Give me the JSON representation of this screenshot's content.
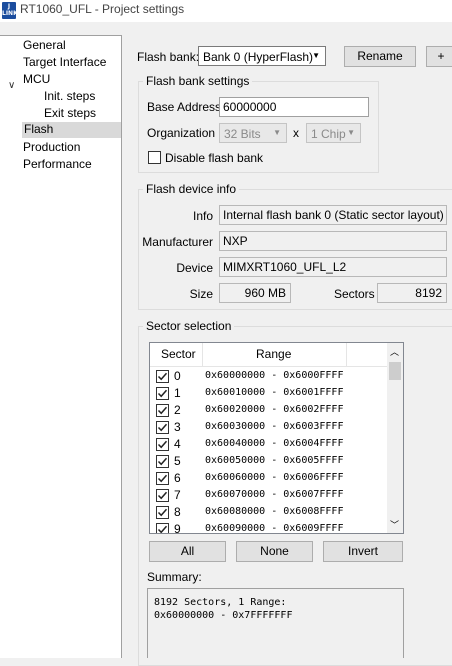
{
  "window": {
    "title": "RT1060_UFL - Project settings",
    "icon_text_top": "J",
    "icon_text_bottom": "LINK"
  },
  "tree": {
    "items": [
      {
        "label": "General"
      },
      {
        "label": "Target Interface"
      },
      {
        "label": "MCU"
      },
      {
        "label": "Init. steps"
      },
      {
        "label": "Exit steps"
      },
      {
        "label": "Flash"
      },
      {
        "label": "Production"
      },
      {
        "label": "Performance"
      }
    ],
    "selected": "Flash"
  },
  "flash_bank": {
    "label": "Flash bank:",
    "selected": "Bank 0 (HyperFlash)",
    "rename_label": "Rename",
    "add_label": "+"
  },
  "bank_settings": {
    "title": "Flash bank settings",
    "base_address_label": "Base Address",
    "base_address": "60000000",
    "organization_label": "Organization",
    "bits": "32 Bits",
    "times": "x",
    "chips": "1 Chip",
    "disable_label": "Disable flash bank",
    "disable_checked": false
  },
  "device_info": {
    "title": "Flash device info",
    "info_label": "Info",
    "info": "Internal flash bank 0 (Static sector layout)",
    "manufacturer_label": "Manufacturer",
    "manufacturer": "NXP",
    "device_label": "Device",
    "device": "MIMXRT1060_UFL_L2",
    "size_label": "Size",
    "size": "960 MB",
    "sectors_label": "Sectors",
    "sectors": "8192"
  },
  "sector_selection": {
    "title": "Sector selection",
    "col_sector": "Sector",
    "col_range": "Range",
    "rows": [
      {
        "num": "0",
        "range": "0x60000000 - 0x6000FFFF",
        "checked": true
      },
      {
        "num": "1",
        "range": "0x60010000 - 0x6001FFFF",
        "checked": true
      },
      {
        "num": "2",
        "range": "0x60020000 - 0x6002FFFF",
        "checked": true
      },
      {
        "num": "3",
        "range": "0x60030000 - 0x6003FFFF",
        "checked": true
      },
      {
        "num": "4",
        "range": "0x60040000 - 0x6004FFFF",
        "checked": true
      },
      {
        "num": "5",
        "range": "0x60050000 - 0x6005FFFF",
        "checked": true
      },
      {
        "num": "6",
        "range": "0x60060000 - 0x6006FFFF",
        "checked": true
      },
      {
        "num": "7",
        "range": "0x60070000 - 0x6007FFFF",
        "checked": true
      },
      {
        "num": "8",
        "range": "0x60080000 - 0x6008FFFF",
        "checked": true
      },
      {
        "num": "9",
        "range": "0x60090000 - 0x6009FFFF",
        "checked": true
      }
    ],
    "all_label": "All",
    "none_label": "None",
    "invert_label": "Invert"
  },
  "summary": {
    "label": "Summary:",
    "text": "8192 Sectors, 1 Range:\n0x60000000 - 0x7FFFFFFF"
  },
  "icons": {
    "combo_arrow": "▼",
    "scroll_up": "︿",
    "scroll_down": "﹀",
    "tree_collapse": "∨"
  }
}
